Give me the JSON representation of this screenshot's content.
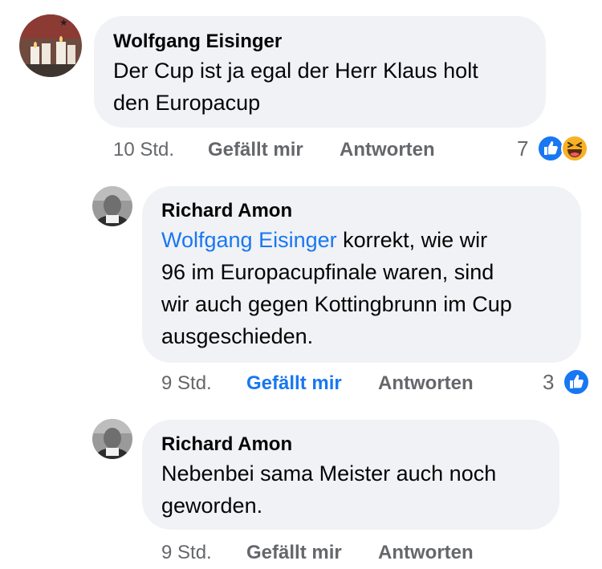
{
  "comments": [
    {
      "author": "Wolfgang Eisinger",
      "lines": [
        "Der Cup ist ja egal der Herr Klaus holt",
        "den Europacup"
      ],
      "time": "10 Std.",
      "like_label": "Gefällt mir",
      "reply_label": "Antworten",
      "reaction_count": "7",
      "reactions": [
        "like-icon",
        "laugh-icon"
      ]
    },
    {
      "author": "Richard Amon",
      "mention": "Wolfgang Eisinger",
      "first_line_rest": " korrekt, wie wir",
      "lines": [
        "96 im Europacupfinale waren, sind",
        "wir auch gegen Kottingbrunn im Cup",
        "ausgeschieden."
      ],
      "time": "9 Std.",
      "like_label": "Gefällt mir",
      "like_active": true,
      "reply_label": "Antworten",
      "reaction_count": "3",
      "reactions": [
        "like-icon"
      ]
    },
    {
      "author": "Richard Amon",
      "lines": [
        "Nebenbei sama Meister auch noch",
        "geworden."
      ],
      "time": "9 Std.",
      "like_label": "Gefällt mir",
      "reply_label": "Antworten"
    }
  ],
  "colors": {
    "bubble": "#f0f2f5",
    "link": "#1877f2",
    "meta": "#65676b",
    "laugh": "#f7b125"
  }
}
